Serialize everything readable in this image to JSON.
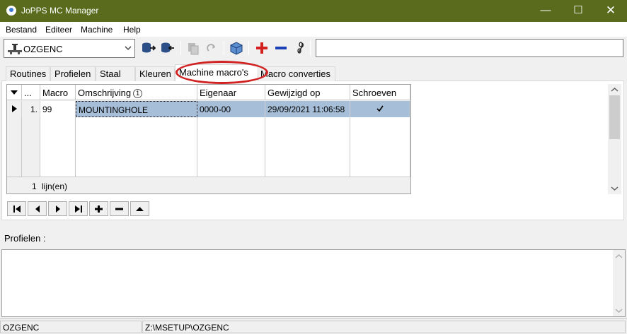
{
  "window": {
    "title": "JoPPS MC Manager"
  },
  "menu": [
    "Bestand",
    "Editeer",
    "Machine",
    "Help"
  ],
  "toolbar": {
    "machine_selected": "OZGENC",
    "field_value": ""
  },
  "tabs": [
    "Routines",
    "Profielen",
    "Staal",
    "Kleuren",
    "Machine macro's",
    "Macro converties"
  ],
  "active_tab": "Machine macro's",
  "grid": {
    "columns": [
      "...",
      "Macro",
      "Omschrijving",
      "Eigenaar",
      "Gewijzigd op",
      "Schroeven"
    ],
    "sort_indicator": "1",
    "rows": [
      {
        "index": "1.",
        "macro": "99",
        "omschrijving": "MOUNTINGHOLE",
        "eigenaar": "0000-00",
        "gewijzigd_op": "29/09/2021 11:06:58",
        "schroeven": true
      }
    ],
    "footer_count": "1",
    "footer_label": "lijn(en)"
  },
  "profielen": {
    "label": "Profielen :",
    "content": ""
  },
  "status": {
    "machine": "OZGENC",
    "path": "Z:\\MSETUP\\OZGENC"
  },
  "colors": {
    "titlebar": "#5a6b1e",
    "selection": "#a6bed7",
    "highlight": "#d12323"
  }
}
